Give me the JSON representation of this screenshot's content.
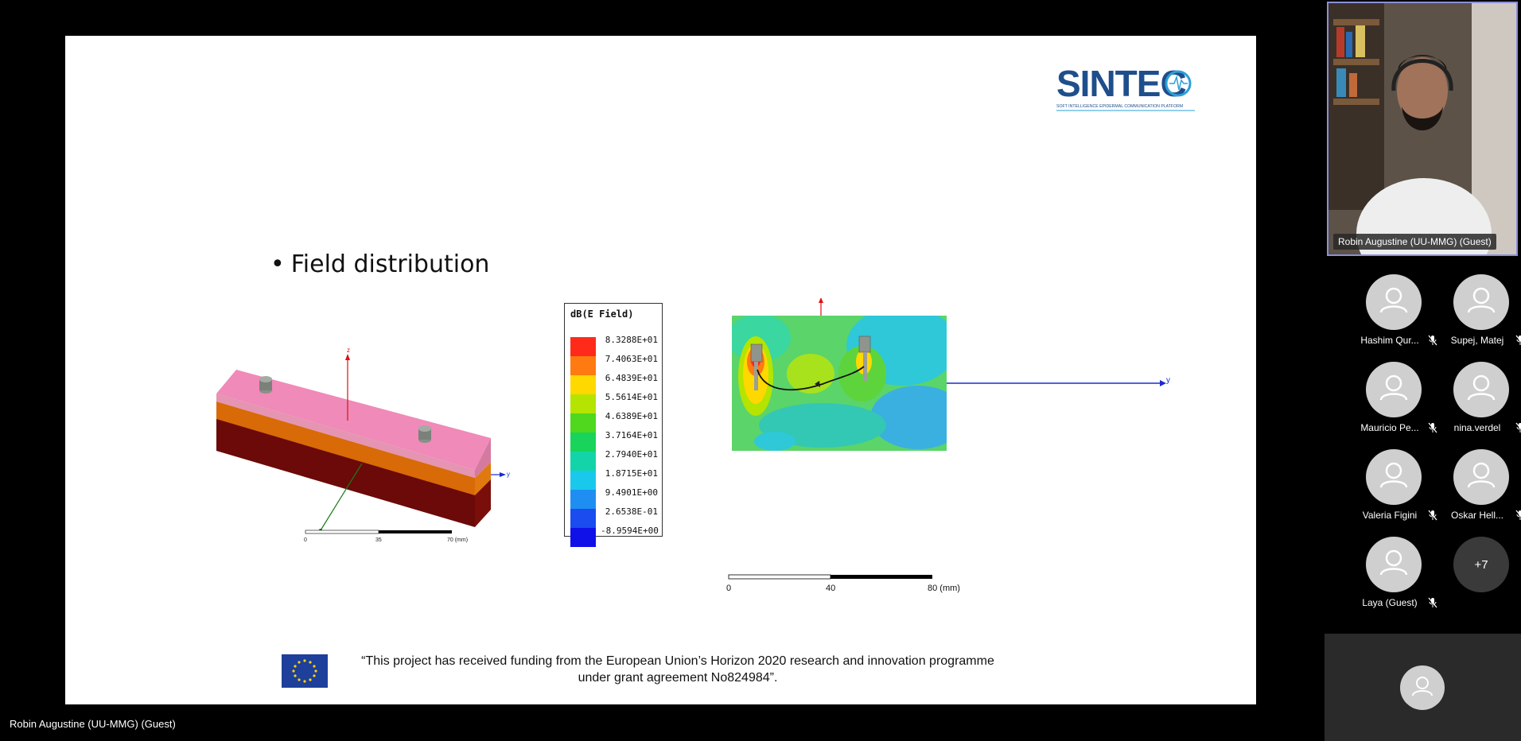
{
  "presenter": {
    "name": "Robin Augustine (UU-MMG) (Guest)"
  },
  "slide": {
    "logo": {
      "text": "SINTEC",
      "tagline": "SOFT INTELLIGENCE EPIDERMAL COMMUNICATION PLATFORM"
    },
    "bullet": "Field distribution",
    "left_figure": {
      "axis_z": "z",
      "axis_y": "y",
      "scale_ticks": [
        "0",
        "35",
        "70 (mm)"
      ]
    },
    "legend": {
      "title": "dB(E Field)",
      "entries": [
        {
          "value": "8.3288E+01",
          "color": "#ff2a1a"
        },
        {
          "value": "7.4063E+01",
          "color": "#ff7a10"
        },
        {
          "value": "6.4839E+01",
          "color": "#ffd800"
        },
        {
          "value": "5.5614E+01",
          "color": "#b4e400"
        },
        {
          "value": "4.6389E+01",
          "color": "#4fd81e"
        },
        {
          "value": "3.7164E+01",
          "color": "#18d45a"
        },
        {
          "value": "2.7940E+01",
          "color": "#12d4a8"
        },
        {
          "value": "1.8715E+01",
          "color": "#1ac8ec"
        },
        {
          "value": "9.4901E+00",
          "color": "#1f8ef2"
        },
        {
          "value": "2.6538E-01",
          "color": "#1a4cf0"
        },
        {
          "value": "-8.9594E+00",
          "color": "#1010e8"
        }
      ]
    },
    "right_figure": {
      "axis_z": "z",
      "axis_y": "y"
    },
    "scale_bar": {
      "ticks": [
        "0",
        "40",
        "80 (mm)"
      ]
    },
    "funding": {
      "line1": "“This project has received funding from the European Union’s Horizon 2020 research and innovation programme",
      "line2": "under grant agreement No824984”."
    }
  },
  "sidebar": {
    "speaker_label": "Robin Augustine (UU-MMG) (Guest)",
    "participants": [
      {
        "name": "Hashim Qur...",
        "muted": true
      },
      {
        "name": "Supej, Matej",
        "muted": true
      },
      {
        "name": "Mauricio Pe...",
        "muted": true
      },
      {
        "name": "nina.verdel",
        "muted": true
      },
      {
        "name": "Valeria Figini",
        "muted": true
      },
      {
        "name": "Oskar Hell...",
        "muted": true
      },
      {
        "name": "Laya (Guest)",
        "muted": true
      }
    ],
    "more_count": "+7"
  }
}
